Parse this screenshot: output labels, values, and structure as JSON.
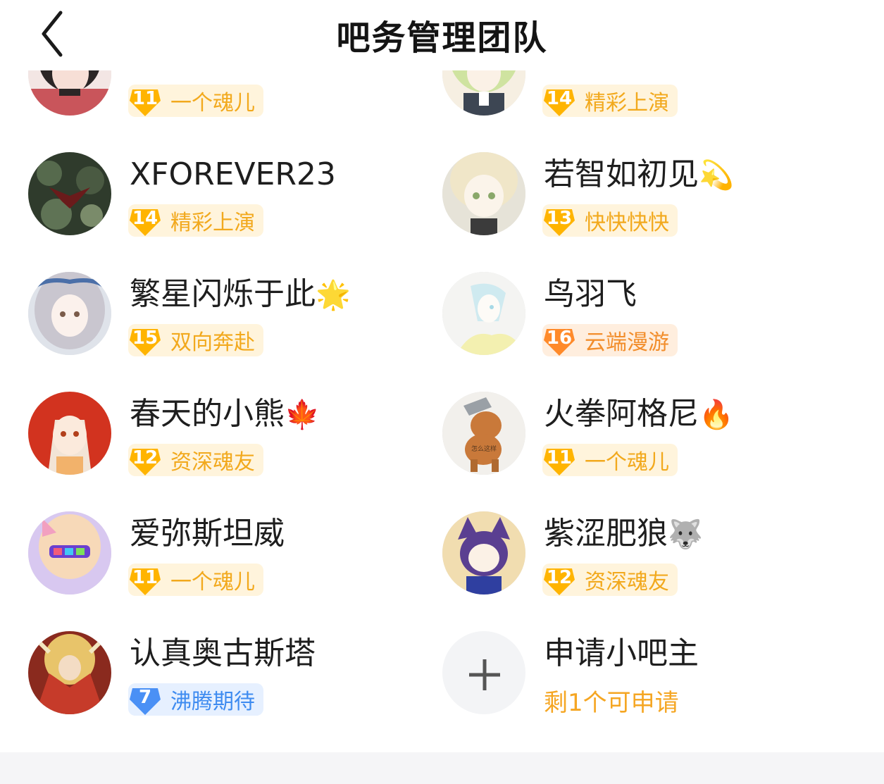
{
  "header": {
    "title": "吧务管理团队",
    "back_icon": "chevron-left-icon"
  },
  "members": [
    {
      "name": "",
      "level": "11",
      "title": "一个魂儿",
      "badge_color": "gold",
      "avatar_colors": [
        "#c9555b",
        "#2b2626"
      ]
    },
    {
      "name": "",
      "level": "14",
      "title": "精彩上演",
      "badge_color": "gold",
      "avatar_colors": [
        "#cfe3a0",
        "#f6efe2"
      ]
    },
    {
      "name": "XFOREVER23",
      "level": "14",
      "title": "精彩上演",
      "badge_color": "gold",
      "avatar_colors": [
        "#2f3b2c",
        "#7a8b6a"
      ]
    },
    {
      "name": "若智如初见",
      "emoji": "💫",
      "level": "13",
      "title": "快快快快",
      "badge_color": "gold",
      "avatar_colors": [
        "#e6e3d8",
        "#b9c89a"
      ]
    },
    {
      "name": "繁星闪烁于此",
      "emoji": "🌟",
      "level": "15",
      "title": "双向奔赴",
      "badge_color": "gold",
      "avatar_colors": [
        "#c9c6cf",
        "#4b6fa8"
      ]
    },
    {
      "name": "鸟羽飞",
      "level": "16",
      "title": "云端漫游",
      "badge_color": "orange",
      "avatar_colors": [
        "#f4f4f2",
        "#a7d9e6"
      ]
    },
    {
      "name": "春天的小熊",
      "emoji": "🍁",
      "level": "12",
      "title": "资深魂友",
      "badge_color": "gold",
      "avatar_colors": [
        "#d2331f",
        "#f2b26b"
      ]
    },
    {
      "name": "火拳阿格尼",
      "emoji": "🔥",
      "level": "11",
      "title": "一个魂儿",
      "badge_color": "gold",
      "avatar_colors": [
        "#f2f0ec",
        "#c9793a"
      ],
      "avatar_caption": "怎么这样"
    },
    {
      "name": "爱弥斯坦威",
      "level": "11",
      "title": "一个魂儿",
      "badge_color": "gold",
      "avatar_colors": [
        "#d8c8f0",
        "#f2a0c0"
      ]
    },
    {
      "name": "紫涩肥狼",
      "emoji": "🐺",
      "level": "12",
      "title": "资深魂友",
      "badge_color": "gold",
      "avatar_colors": [
        "#f1ddb0",
        "#5a3f91"
      ]
    },
    {
      "name": "认真奥古斯塔",
      "level": "7",
      "title": "沸腾期待",
      "badge_color": "blue",
      "avatar_colors": [
        "#c63b2a",
        "#e8c46a"
      ]
    }
  ],
  "apply": {
    "title": "申请小吧主",
    "subtitle": "剩1个可申请",
    "icon": "plus-icon"
  },
  "colors": {
    "gold_badge": "#ffb400",
    "blue_badge": "#4a90f5",
    "orange_badge": "#ff8a2a",
    "accent_text": "#f5a623"
  }
}
